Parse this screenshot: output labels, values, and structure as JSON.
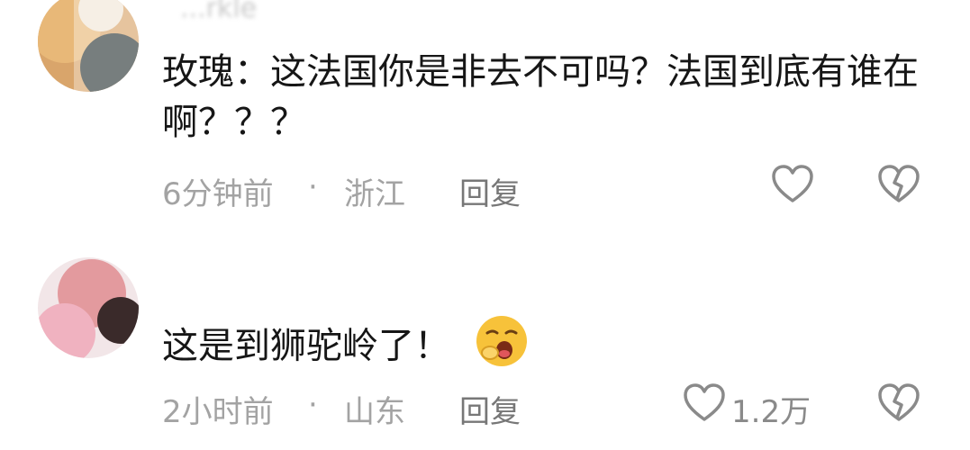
{
  "comments": [
    {
      "username": "...rkle",
      "text": "玫瑰：这法国你是非去不可吗？法国到底有谁在啊？？？",
      "time": "6分钟前",
      "separator": "·",
      "location": "浙江",
      "reply_label": "回复",
      "like_count": ""
    },
    {
      "username": "",
      "text": "这是到狮驼岭了！",
      "emoji": "yawning-face",
      "time": "2小时前",
      "separator": "·",
      "location": "山东",
      "reply_label": "回复",
      "like_count": "1.2万"
    }
  ],
  "colors": {
    "text": "#161616",
    "meta": "#a3a3a3",
    "icon": "#8a8a8a"
  }
}
